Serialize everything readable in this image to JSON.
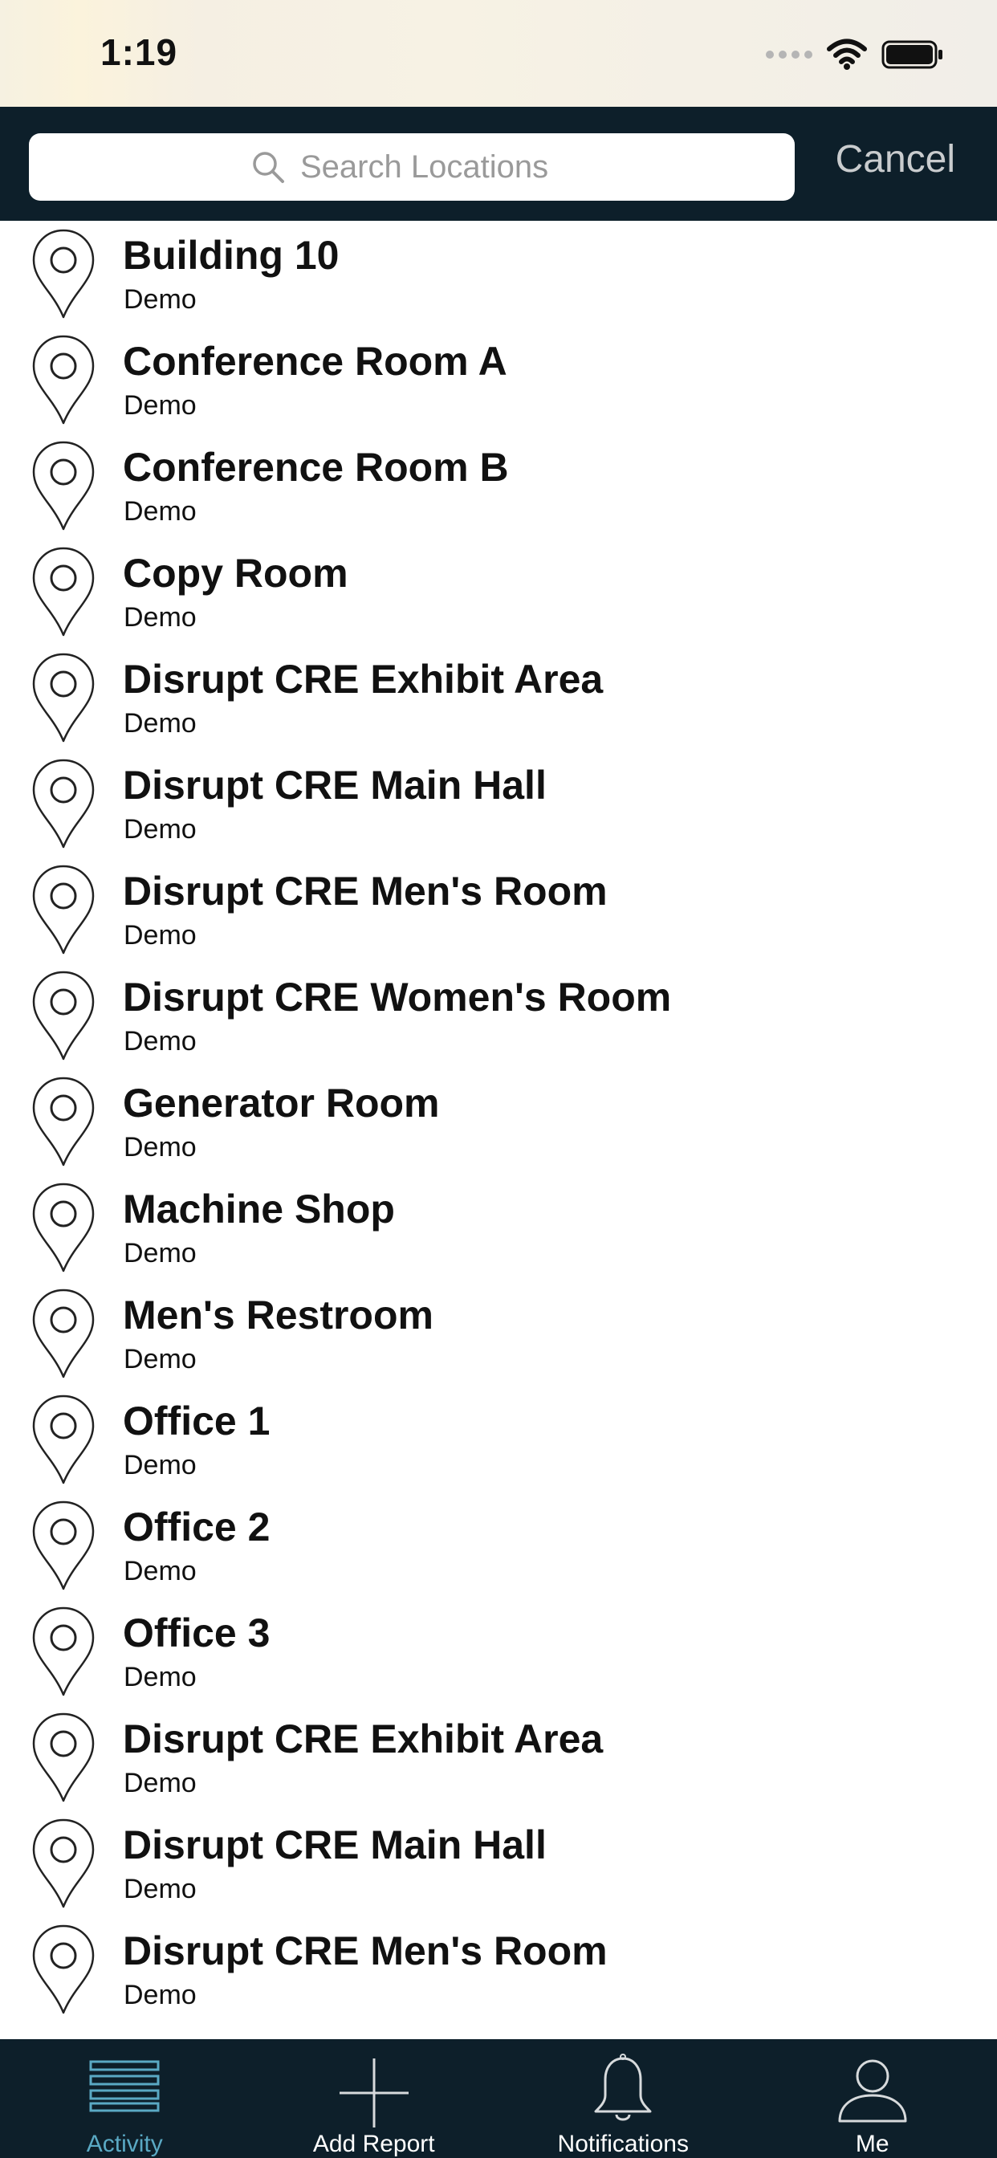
{
  "status_bar": {
    "time": "1:19"
  },
  "search": {
    "placeholder": "Search Locations",
    "value": "",
    "cancel_label": "Cancel"
  },
  "locations": [
    {
      "name": "Building 10",
      "group": "Demo"
    },
    {
      "name": "Conference Room A",
      "group": "Demo"
    },
    {
      "name": "Conference Room B",
      "group": "Demo"
    },
    {
      "name": "Copy Room",
      "group": "Demo"
    },
    {
      "name": "Disrupt CRE Exhibit Area",
      "group": "Demo"
    },
    {
      "name": "Disrupt CRE Main Hall",
      "group": "Demo"
    },
    {
      "name": "Disrupt CRE Men's Room",
      "group": "Demo"
    },
    {
      "name": "Disrupt CRE Women's Room",
      "group": "Demo"
    },
    {
      "name": "Generator Room",
      "group": "Demo"
    },
    {
      "name": "Machine Shop",
      "group": "Demo"
    },
    {
      "name": "Men's Restroom",
      "group": "Demo"
    },
    {
      "name": "Office 1",
      "group": "Demo"
    },
    {
      "name": "Office 2",
      "group": "Demo"
    },
    {
      "name": "Office 3",
      "group": "Demo"
    },
    {
      "name": "Disrupt CRE Exhibit Area",
      "group": "Demo"
    },
    {
      "name": "Disrupt CRE Main Hall",
      "group": "Demo"
    },
    {
      "name": "Disrupt CRE Men's Room",
      "group": "Demo"
    }
  ],
  "tab_bar": {
    "tabs": [
      {
        "label": "Activity",
        "icon": "menu-lines-icon",
        "active": true
      },
      {
        "label": "Add Report",
        "icon": "plus-icon",
        "active": false
      },
      {
        "label": "Notifications",
        "icon": "bell-icon",
        "active": false
      },
      {
        "label": "Me",
        "icon": "person-icon",
        "active": false
      }
    ]
  },
  "colors": {
    "header_bg": "#0d1f2a",
    "active_tab": "#5aa9c4",
    "cancel_text": "#c9ccce"
  }
}
